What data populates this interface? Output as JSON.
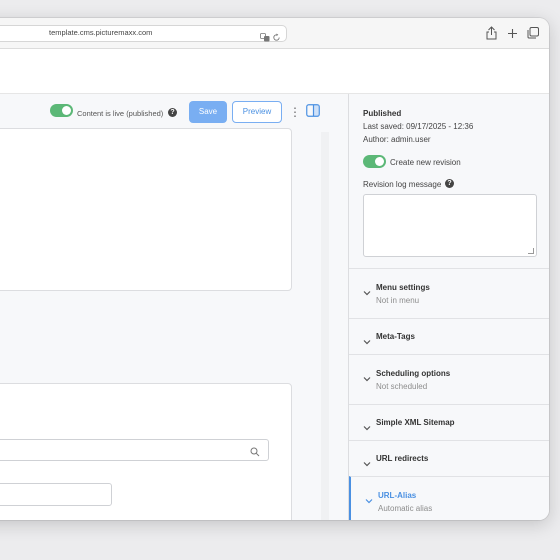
{
  "browser": {
    "url": "template.cms.picturemaxx.com"
  },
  "toolbar": {
    "live_label": "Content is live (published)",
    "help_glyph": "?",
    "save_label": "Save",
    "preview_label": "Preview",
    "more_glyph": "⋮"
  },
  "sidebar": {
    "status": "Published",
    "last_saved": "Last saved: 09/17/2025 - 12:36",
    "author": "Author: admin.user",
    "revision_toggle_label": "Create new revision",
    "revision_log_label": "Revision log message",
    "sections": [
      {
        "title": "Menu settings",
        "subtitle": "Not in menu"
      },
      {
        "title": "Meta-Tags",
        "subtitle": ""
      },
      {
        "title": "Scheduling options",
        "subtitle": "Not scheduled"
      },
      {
        "title": "Simple XML Sitemap",
        "subtitle": ""
      },
      {
        "title": "URL redirects",
        "subtitle": ""
      },
      {
        "title": "URL-Alias",
        "subtitle": "Automatic alias"
      }
    ]
  },
  "colors": {
    "accent": "#4a90e2",
    "toggle_on": "#5cb877",
    "save_button": "#79aef2"
  }
}
